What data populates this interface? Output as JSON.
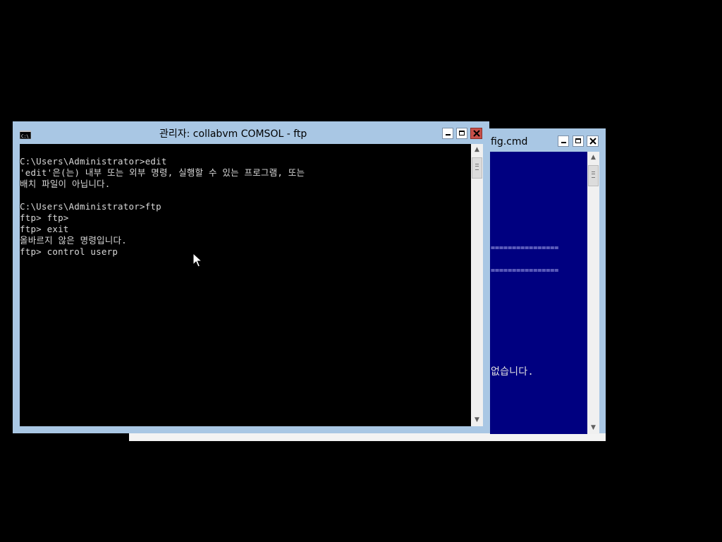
{
  "back_window": {
    "title": "fig.cmd",
    "separator_1": "================",
    "separator_2": "================",
    "text_1": "없습니다."
  },
  "front_window": {
    "title": "관리자:  collabvm COMSOL - ftp",
    "console_lines": [
      "C:\\Users\\Administrator>edit",
      "'edit'은(는) 내부 또는 외부 명령, 실행할 수 있는 프로그램, 또는",
      "배치 파일이 아닙니다.",
      "",
      "C:\\Users\\Administrator>ftp",
      "ftp> ftp>",
      "ftp> exit",
      "올바르지 않은 명령입니다.",
      "ftp> control userp"
    ]
  },
  "colors": {
    "frame": "#a9c7e4",
    "console_bg": "#000000",
    "console_fg": "#d8d8d8",
    "back_console_bg": "#000080",
    "close_red": "#c7504a"
  },
  "icons": [
    "console-icon",
    "minimize-icon",
    "maximize-icon",
    "close-icon",
    "mouse-pointer-icon"
  ]
}
